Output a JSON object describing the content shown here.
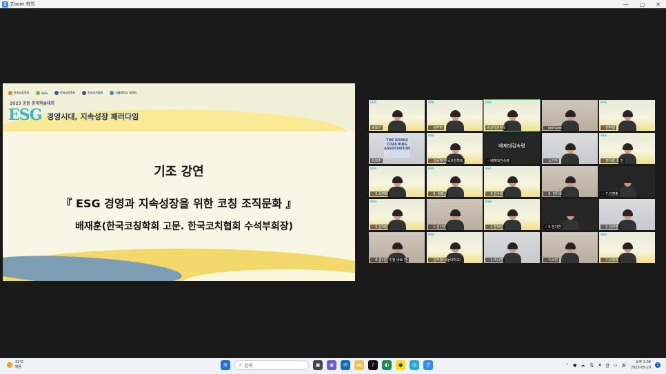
{
  "window": {
    "title": "Zoom 회의",
    "controls": [
      "—",
      "▢",
      "✕"
    ]
  },
  "slide": {
    "logos": [
      "한국코칭학회",
      "ESG",
      "한국코칭학회",
      "한국코치협회",
      "서울대학교 대학원"
    ],
    "event_line": "2023 공동 춘계학술대회",
    "esg_word": "ESG",
    "theme": "경영시대, 지속성장 패러다임",
    "title": "기조 강연",
    "topic": "『 ESG 경영과 지속성장을 위한 코칭 조직문화 』",
    "speaker": "배재훈(한국코칭학회 고문. 한국코치협회 수석부회장)"
  },
  "gallery": [
    {
      "name": "송호건",
      "bg": "slide",
      "mic_off": false
    },
    {
      "name": "김훈영",
      "bg": "slide",
      "mic_off": true
    },
    {
      "name": "숭실대김정옥",
      "bg": "slide",
      "mic_off": false,
      "active": true
    },
    {
      "name": "jaehoon",
      "bg": "room",
      "mic_off": true
    },
    {
      "name": "민환형",
      "bg": "slide",
      "mic_off": true
    },
    {
      "name": "최희주",
      "bg": "logo",
      "mic_off": false,
      "logo_text": "THE KOREA COACHING ASSOCIATION"
    },
    {
      "name": "김용자(한국코칭학회",
      "bg": "slide",
      "mic_off": true
    },
    {
      "name": "배재대김숙령",
      "bg": "dark",
      "mic_off": true,
      "center_text": "배재대김숙령"
    },
    {
      "name": "노기자",
      "bg": "grey",
      "mic_off": true
    },
    {
      "name": "모아랑 초 전",
      "bg": "slide",
      "mic_off": true
    },
    {
      "name": "6.육영화",
      "bg": "slide",
      "mic_off": true
    },
    {
      "name": "6. 정홍균",
      "bg": "slide",
      "mic_off": true
    },
    {
      "name": "3.김수희",
      "bg": "slide",
      "mic_off": true
    },
    {
      "name": "5. 장유호",
      "bg": "room",
      "mic_off": true
    },
    {
      "name": "7.김영출",
      "bg": "dark",
      "mic_off": true
    },
    {
      "name": "5.김희정",
      "bg": "slide",
      "mic_off": true
    },
    {
      "name": "1.설인연",
      "bg": "room",
      "mic_off": true
    },
    {
      "name": "1.현미란",
      "bg": "slide",
      "mic_off": true
    },
    {
      "name": "5.현지연",
      "bg": "dark",
      "mic_off": true
    },
    {
      "name": "1.김미영",
      "bg": "grey",
      "mic_off": true
    },
    {
      "name": "8.홍이원 미정 바로 환",
      "bg": "room",
      "mic_off": true
    },
    {
      "name": "김지영(서울대학교)",
      "bg": "slide",
      "mic_off": true
    },
    {
      "name": "1.박나영",
      "bg": "grey",
      "mic_off": true
    },
    {
      "name": "이소영",
      "bg": "room",
      "mic_off": true
    },
    {
      "name": "7.유홍래",
      "bg": "slide",
      "mic_off": true
    }
  ],
  "taskbar": {
    "weather_temp": "21°C",
    "weather_desc": "맑음",
    "search_placeholder": "검색",
    "tray_lang": "한",
    "tray_a": "A",
    "clock_time": "오후 1:09",
    "clock_date": "2023-05-20",
    "notif_count": "1"
  }
}
